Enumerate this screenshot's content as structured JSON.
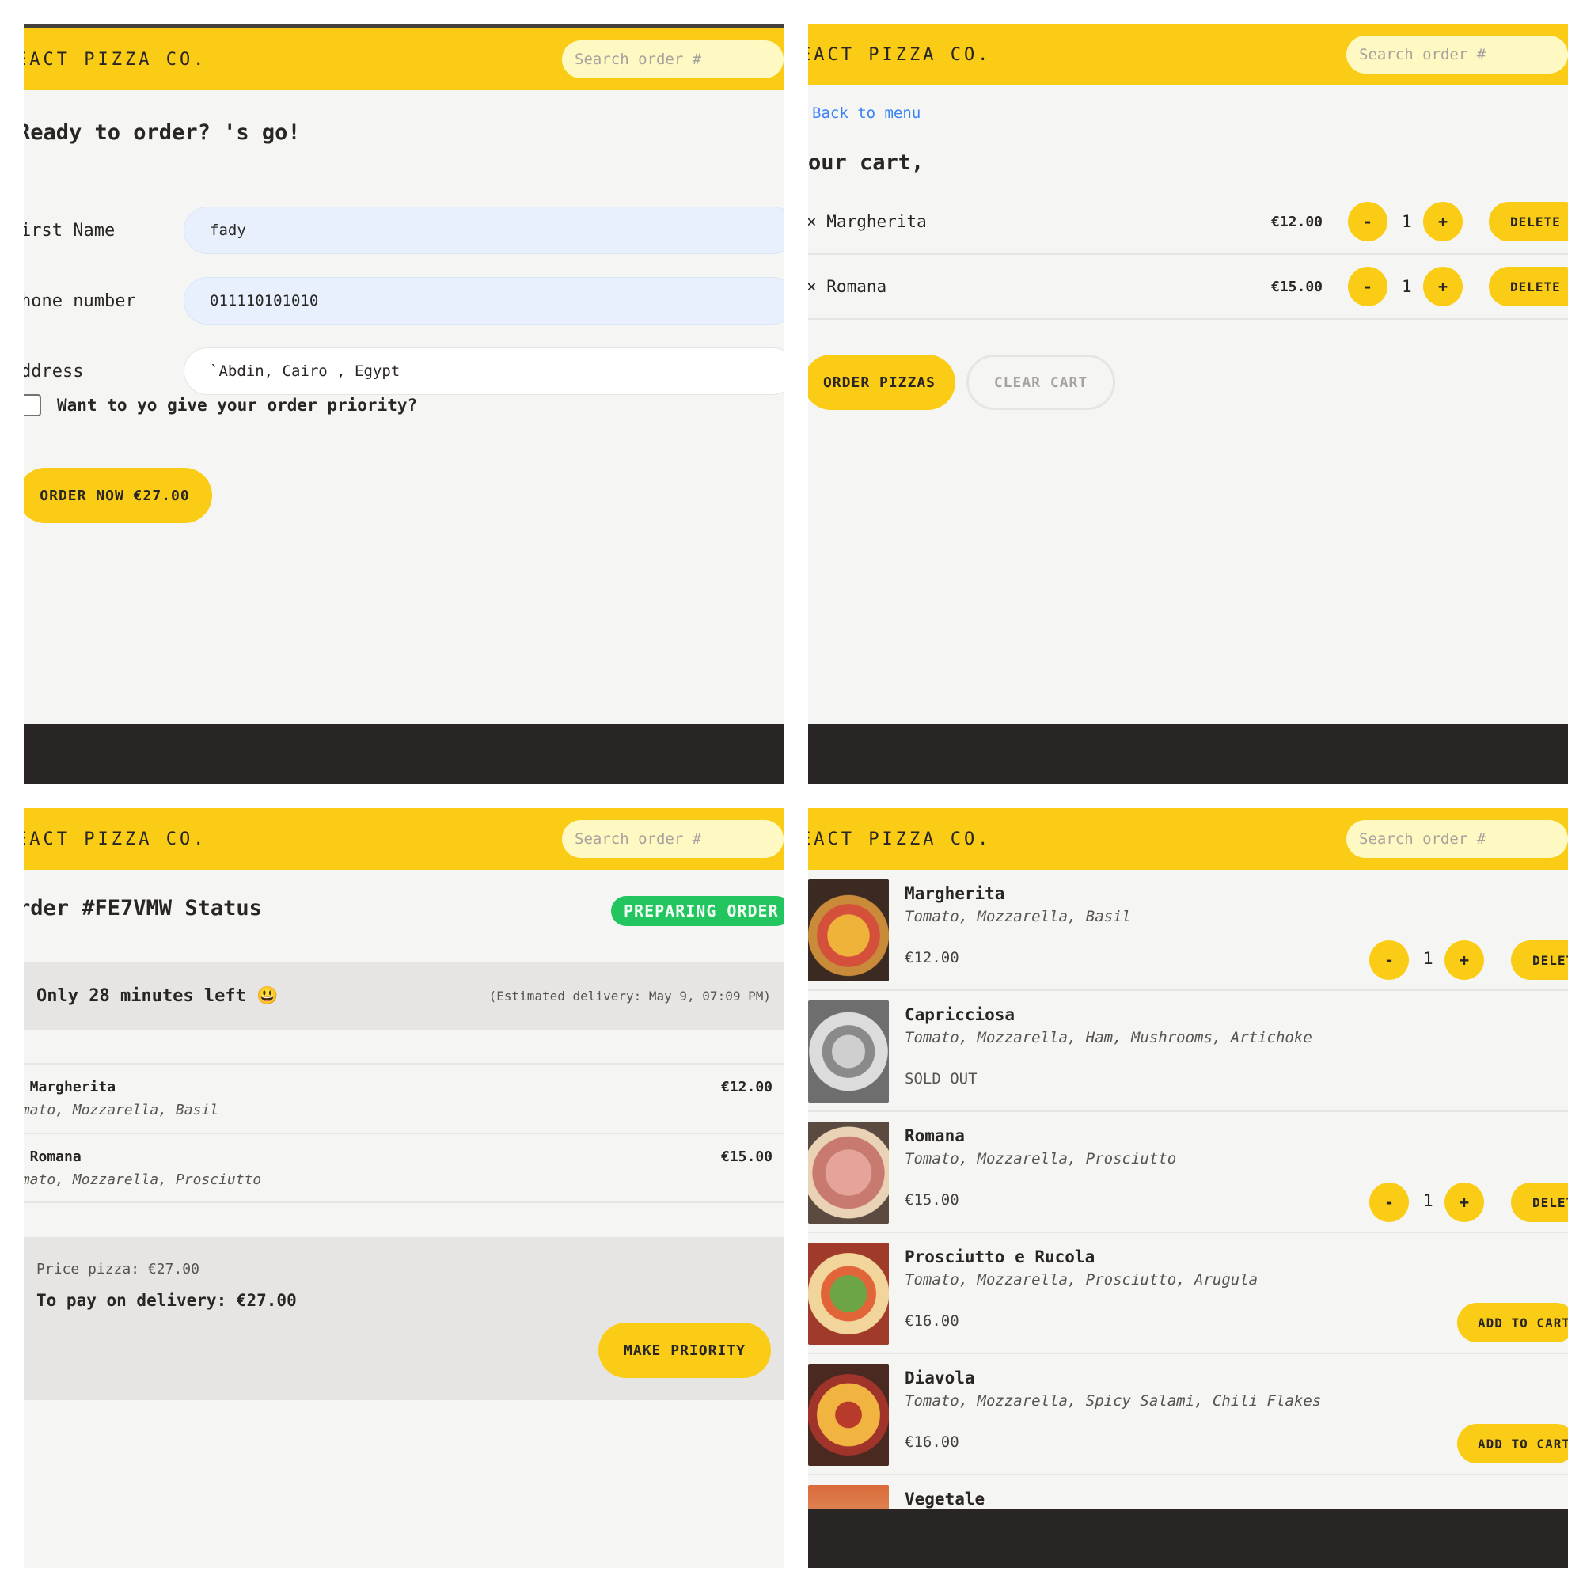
{
  "app": {
    "logo": "EACT PIZZA CO.",
    "search_placeholder": "Search order #"
  },
  "colors": {
    "accent": "#facc15",
    "footer": "#292524",
    "status_green": "#22c55e",
    "link": "#3b82f6"
  },
  "order_form": {
    "title": "Ready to order? 's go!",
    "fields": [
      {
        "label": "irst Name",
        "value": "fady"
      },
      {
        "label": "hone number",
        "value": "011110101010"
      },
      {
        "label": "ddress",
        "value": "`Abdin, Cairo , Egypt"
      }
    ],
    "priority_label": "Want to yo give your order priority?",
    "priority_checked": false,
    "submit_label": "ORDER NOW €27.00"
  },
  "cart": {
    "back_label": "Back to menu",
    "title": "our cart,",
    "items": [
      {
        "name": "× Margherita",
        "price": "€12.00",
        "qty": "1"
      },
      {
        "name": "× Romana",
        "price": "€15.00",
        "qty": "1"
      }
    ],
    "minus_label": "-",
    "plus_label": "+",
    "delete_label": "DELETE",
    "order_label": "ORDER PIZZAS",
    "clear_label": "CLEAR CART"
  },
  "status": {
    "title": "rder #FE7VMW Status",
    "badge": "PREPARING ORDER",
    "time_left": "Only 28 minutes left 😃",
    "estimated": "(Estimated delivery: May 9, 07:09 PM)",
    "items": [
      {
        "name": "× Margherita",
        "ingredients": "omato, Mozzarella, Basil",
        "price": "€12.00"
      },
      {
        "name": "× Romana",
        "ingredients": "omato, Mozzarella, Prosciutto",
        "price": "€15.00"
      }
    ],
    "price_pizza": "Price pizza: €27.00",
    "to_pay": "To pay on delivery: €27.00",
    "priority_button": "MAKE PRIORITY"
  },
  "menu": {
    "items": [
      {
        "name": "Margherita",
        "ingredients": "Tomato, Mozzarella, Basil",
        "price": "€12.00",
        "qty": "1",
        "in_cart": true,
        "sold_out": false
      },
      {
        "name": "Capricciosa",
        "ingredients": "Tomato, Mozzarella, Ham, Mushrooms, Artichoke",
        "status": "SOLD OUT",
        "sold_out": true
      },
      {
        "name": "Romana",
        "ingredients": "Tomato, Mozzarella, Prosciutto",
        "price": "€15.00",
        "qty": "1",
        "in_cart": true,
        "sold_out": false
      },
      {
        "name": "Prosciutto e Rucola",
        "ingredients": "Tomato, Mozzarella, Prosciutto, Arugula",
        "price": "€16.00",
        "in_cart": false,
        "sold_out": false
      },
      {
        "name": "Diavola",
        "ingredients": "Tomato, Mozzarella, Spicy Salami, Chili Flakes",
        "price": "€16.00",
        "in_cart": false,
        "sold_out": false
      },
      {
        "name": "Vegetale"
      }
    ],
    "add_label": "ADD TO CART",
    "delete_label": "DELETE",
    "minus_label": "-",
    "plus_label": "+"
  }
}
